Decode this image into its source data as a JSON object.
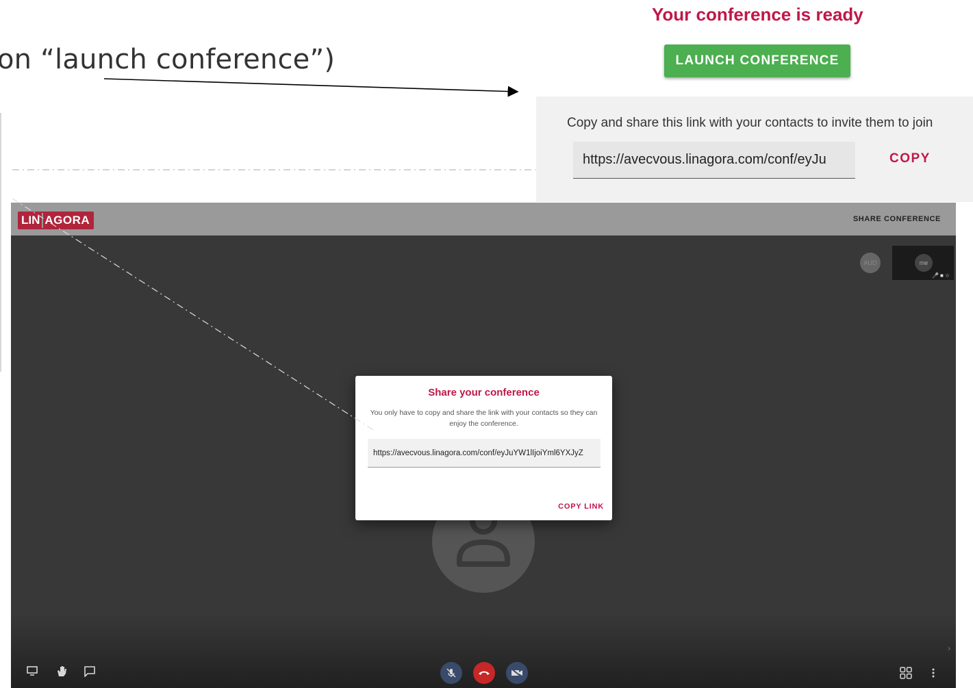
{
  "instruction": {
    "text": "on “launch conference”)"
  },
  "promo": {
    "ready_title": "Your conference is ready",
    "launch_label": "LAUNCH CONFERENCE",
    "share_text": "Copy and share this link with your contacts to invite them to join",
    "link_value": "https://avecvous.linagora.com/conf/eyJu",
    "copy_label": "COPY"
  },
  "conference": {
    "logo_left": "LIN",
    "logo_right": "AGORA",
    "share_conference_label": "SHARE CONFERENCE",
    "participant_initials": "AUD",
    "self_label": "me",
    "modal": {
      "title": "Share your conference",
      "description": "You only have to copy and share the link with your contacts so they can enjoy the conference.",
      "link_value": "https://avecvous.linagora.com/conf/eyJuYW1lIjoiYml6YXJyZ",
      "copy_link_label": "COPY LINK"
    },
    "toolbar": {
      "left_icons": [
        "screen-share-icon",
        "raise-hand-icon",
        "chat-icon"
      ],
      "center_icons": [
        "mic-off-icon",
        "hangup-icon",
        "video-off-icon"
      ],
      "right_icons": [
        "tile-view-icon",
        "more-vertical-icon"
      ]
    }
  },
  "colors": {
    "accent": "#c0174a",
    "launch_green": "#4caf50",
    "hangup_red": "#c62828",
    "toolbar_button": "#3a4a6a"
  }
}
